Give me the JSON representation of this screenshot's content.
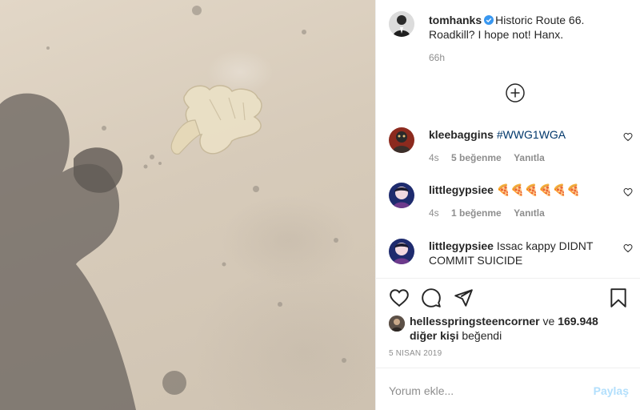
{
  "caption": {
    "username": "tomhanks",
    "text": "Historic Route 66. Roadkill? I hope not! Hanx.",
    "time": "66h",
    "avatar_icon": "tomhanks-avatar",
    "verified_icon": "verified-badge-icon"
  },
  "comments": [
    {
      "username": "kleebaggins",
      "text": "#WWG1WGA",
      "time": "4s",
      "likes": "5 beğenme",
      "reply": "Yanıtla"
    },
    {
      "username": "littlegypsiee",
      "text": "🍕🍕🍕🍕🍕🍕",
      "time": "4s",
      "likes": "1 beğenme",
      "reply": "Yanıtla"
    },
    {
      "username": "littlegypsiee",
      "text": "Issac kappy DIDNT COMMIT SUICIDE"
    }
  ],
  "likes": {
    "liker": "hellesspringsteencorner",
    "connector": "ve",
    "others": "169.948 diğer kişi",
    "suffix": "beğendi"
  },
  "date": "5 Nisan 2019",
  "comment_box": {
    "placeholder": "Yorum ekle...",
    "share_label": "Paylaş"
  },
  "colors": {
    "verified": "#3897f0",
    "hashtag": "#00376b",
    "muted": "#8e8e8e",
    "share_disabled": "#b2dffc"
  }
}
